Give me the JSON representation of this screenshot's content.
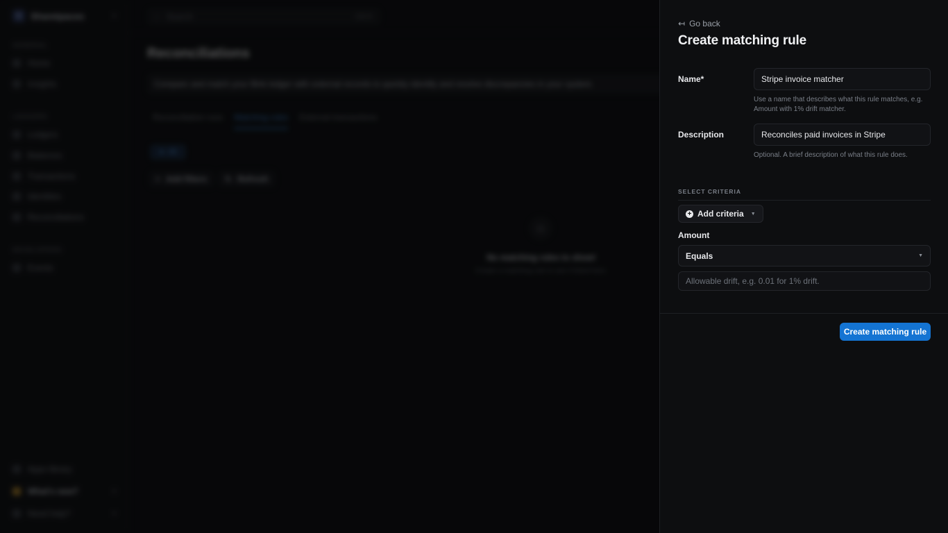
{
  "background": {
    "workspace": {
      "name": "Sharetpaces",
      "badge": "S"
    },
    "sidebar": {
      "sections": [
        {
          "title": "GENERAL",
          "items": [
            "Home",
            "Insights"
          ]
        },
        {
          "title": "LEDGERS",
          "items": [
            "Ledgers",
            "Balances",
            "Transactions",
            "Identities",
            "Reconciliations"
          ]
        },
        {
          "title": "DEVELOPERS",
          "items": [
            "Events"
          ]
        }
      ],
      "footer": [
        "Apps library",
        "What's new?",
        "Need help?"
      ]
    },
    "search": {
      "placeholder": "Search",
      "shortcut": "Ctrl K"
    },
    "page_title": "Reconciliations",
    "banner": "Compare and match your Blnk ledger with external records to quickly identify and resolve discrepancies in your system.",
    "tabs": [
      "Reconciliation runs",
      "Matching rules",
      "External transactions"
    ],
    "active_tab": "Matching rules",
    "chip": "All",
    "toolbar": {
      "add_filters": "Add filters",
      "refresh": "Refresh"
    },
    "empty": {
      "title": "No matching rules to show!",
      "subtitle": "Create a matching rule to see it listed here."
    }
  },
  "drawer": {
    "go_back": "Go back",
    "title": "Create matching rule",
    "name": {
      "label": "Name*",
      "value": "Stripe invoice matcher",
      "help": "Use a name that describes what this rule matches, e.g. Amount with 1% drift matcher."
    },
    "description": {
      "label": "Description",
      "value": "Reconciles paid invoices in Stripe",
      "help": "Optional. A brief description of what this rule does."
    },
    "criteria_header": "SELECT CRITERIA",
    "add_criteria": "Add criteria",
    "amount": {
      "label": "Amount",
      "operator": "Equals",
      "drift_placeholder": "Allowable drift, e.g. 0.01 for 1% drift."
    },
    "submit": "Create matching rule",
    "accent_color": "#1474d3"
  }
}
